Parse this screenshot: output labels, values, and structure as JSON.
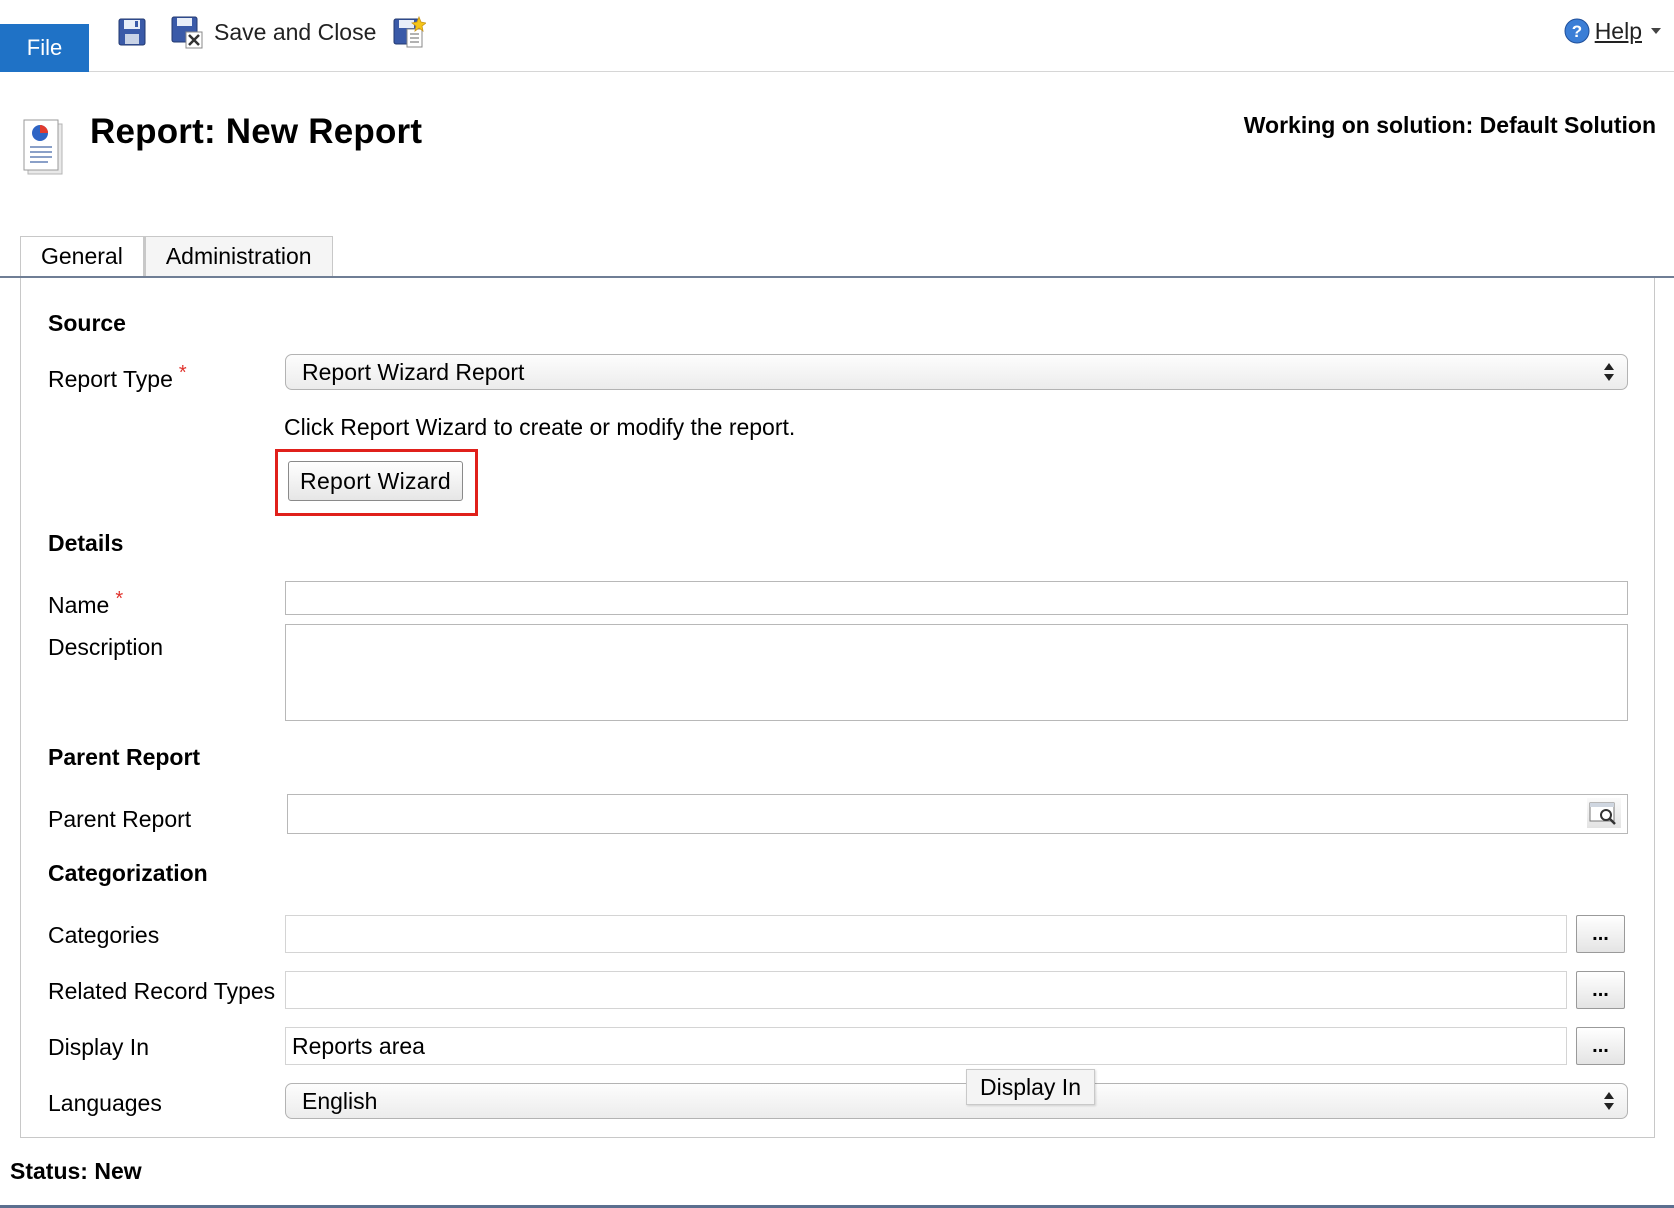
{
  "ribbon": {
    "file_label": "File",
    "save_close_label": "Save and Close",
    "help_label": "Help",
    "icons": [
      "save-icon",
      "save-close-icon",
      "save-new-icon",
      "help-icon",
      "caret-down-icon"
    ]
  },
  "header": {
    "title": "Report: New Report",
    "solution": "Working on solution: Default Solution"
  },
  "tabs": [
    {
      "label": "General",
      "active": true
    },
    {
      "label": "Administration",
      "active": false
    }
  ],
  "sections": {
    "source": "Source",
    "details": "Details",
    "parent_report": "Parent Report",
    "categorization": "Categorization"
  },
  "fields": {
    "report_type": {
      "label": "Report Type",
      "required": "*",
      "value": "Report Wizard Report"
    },
    "hint": "Click Report Wizard to create or modify the report.",
    "wizard_button": "Report Wizard",
    "name": {
      "label": "Name",
      "required": "*",
      "value": ""
    },
    "description": {
      "label": "Description",
      "value": ""
    },
    "parent_report": {
      "label": "Parent Report",
      "value": ""
    },
    "categories": {
      "label": "Categories",
      "value": "",
      "button": "..."
    },
    "related_record_types": {
      "label": "Related Record Types",
      "value": "",
      "button": "..."
    },
    "display_in": {
      "label": "Display In",
      "value": "Reports area",
      "button": "..."
    },
    "languages": {
      "label": "Languages",
      "value": "English"
    }
  },
  "tooltip": "Display In",
  "status": "Status: New",
  "colors": {
    "file_tab": "#1f72c6",
    "required_star": "#e0322c",
    "highlight_border": "#e0201b",
    "tab_rule": "#6f7e95"
  }
}
